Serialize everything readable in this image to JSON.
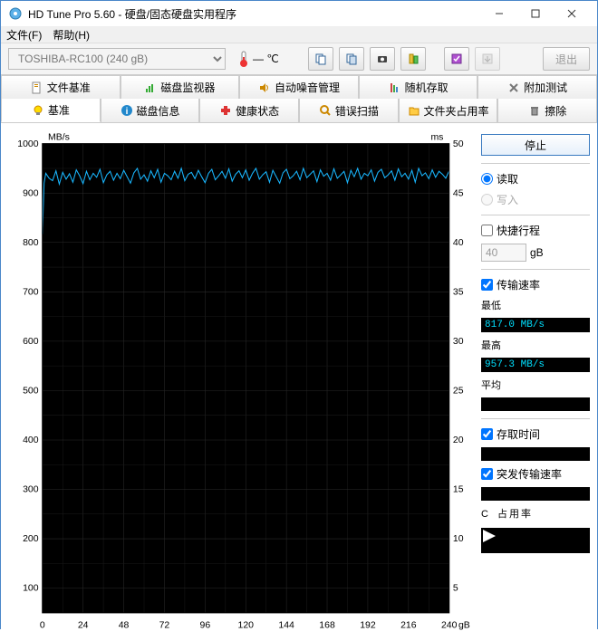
{
  "window": {
    "title": "HD Tune Pro 5.60 - 硬盘/固态硬盘实用程序"
  },
  "menubar": {
    "file": "文件(F)",
    "help": "帮助(H)"
  },
  "toolbar": {
    "drive_selected": "TOSHIBA-RC100 (240 gB)",
    "temperature": "— ℃",
    "exit_label": "退出"
  },
  "tabs_upper": [
    {
      "label": "文件基准",
      "icon": "doc"
    },
    {
      "label": "磁盘监视器",
      "icon": "chart"
    },
    {
      "label": "自动噪音管理",
      "icon": "speaker"
    },
    {
      "label": "随机存取",
      "icon": "bars"
    },
    {
      "label": "附加测试",
      "icon": "tools"
    }
  ],
  "tabs_lower": [
    {
      "label": "基准",
      "icon": "bulb",
      "active": true
    },
    {
      "label": "磁盘信息",
      "icon": "info"
    },
    {
      "label": "健康状态",
      "icon": "health"
    },
    {
      "label": "错误扫描",
      "icon": "search"
    },
    {
      "label": "文件夹占用率",
      "icon": "folder"
    },
    {
      "label": "擦除",
      "icon": "trash"
    }
  ],
  "side": {
    "action_button": "停止",
    "radio_read": "读取",
    "radio_write": "写入",
    "radio_selected": "read",
    "check_shortstroke": "快捷行程",
    "shortstroke_checked": false,
    "shortstroke_size": "40",
    "size_unit": "gB",
    "check_transfer": "传输速率",
    "transfer_checked": true,
    "min_label": "最低",
    "min_value": "817.0 MB/s",
    "max_label": "最高",
    "max_value": "957.3 MB/s",
    "avg_label": "平均",
    "avg_value": "",
    "check_access": "存取时间",
    "access_checked": true,
    "access_value": "",
    "check_burst": "突发传输速率",
    "burst_checked": true,
    "burst_value": "",
    "cpu_label": "CPU占用率"
  },
  "chart_data": {
    "type": "line",
    "title": "",
    "x_unit": "gB",
    "y_left_label": "MB/s",
    "y_right_label": "ms",
    "x_ticks": [
      0,
      24,
      48,
      72,
      96,
      120,
      144,
      168,
      192,
      216,
      240
    ],
    "y_left_ticks": [
      100,
      200,
      300,
      400,
      500,
      600,
      700,
      800,
      900,
      1000
    ],
    "y_right_ticks": [
      5,
      10,
      15,
      20,
      25,
      30,
      35,
      40,
      45,
      50
    ],
    "ylim_left": [
      50,
      1000
    ],
    "ylim_right": [
      2.5,
      50
    ],
    "xlim": [
      0,
      240
    ],
    "series": [
      {
        "name": "transfer_rate",
        "axis": "left",
        "color": "#19b7ff",
        "x": [
          0,
          1,
          2,
          4,
          6,
          8,
          10,
          12,
          14,
          16,
          18,
          20,
          22,
          24,
          26,
          28,
          30,
          32,
          34,
          36,
          38,
          40,
          42,
          44,
          46,
          48,
          50,
          52,
          54,
          56,
          58,
          60,
          62,
          64,
          66,
          68,
          70,
          72,
          74,
          76,
          78,
          80,
          82,
          84,
          86,
          88,
          90,
          92,
          94,
          96,
          98,
          100,
          102,
          104,
          106,
          108,
          110,
          112,
          114,
          116,
          118,
          120,
          122,
          124,
          126,
          128,
          130,
          132,
          134,
          136,
          138,
          140,
          142,
          144,
          146,
          148,
          150,
          152,
          154,
          156,
          158,
          160,
          162,
          164,
          166,
          168,
          170,
          172,
          174,
          176,
          178,
          180,
          182,
          184,
          186,
          188,
          190,
          192,
          194,
          196,
          198,
          200,
          202,
          204,
          206,
          208,
          210,
          212,
          214,
          216,
          218,
          220,
          222,
          224,
          226,
          228,
          230,
          232,
          234,
          236,
          238,
          240
        ],
        "values": [
          817,
          920,
          940,
          930,
          925,
          945,
          918,
          942,
          928,
          939,
          922,
          947,
          935,
          919,
          944,
          927,
          940,
          932,
          948,
          921,
          937,
          944,
          926,
          940,
          929,
          946,
          933,
          920,
          941,
          950,
          928,
          937,
          924,
          945,
          931,
          948,
          922,
          940,
          935,
          927,
          944,
          930,
          950,
          925,
          938,
          942,
          929,
          946,
          933,
          921,
          940,
          948,
          927,
          935,
          944,
          930,
          949,
          924,
          938,
          945,
          931,
          947,
          926,
          940,
          950,
          928,
          937,
          943,
          922,
          946,
          933,
          920,
          941,
          948,
          929,
          935,
          944,
          927,
          950,
          931,
          938,
          945,
          923,
          947,
          934,
          940,
          926,
          949,
          930,
          937,
          944,
          921,
          946,
          933,
          950,
          928,
          940,
          935,
          947,
          924,
          942,
          948,
          931,
          937,
          945,
          926,
          949,
          933,
          940,
          928,
          946,
          922,
          950,
          935,
          941,
          929,
          947,
          932,
          944,
          938,
          930,
          945
        ]
      }
    ]
  }
}
